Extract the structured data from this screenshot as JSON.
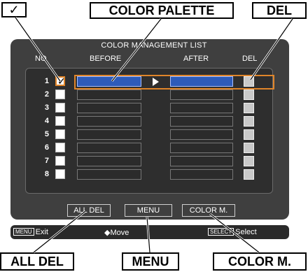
{
  "callouts": {
    "checkbox": "✓",
    "palette": "COLOR PALETTE",
    "del": "DEL",
    "all_del": "ALL DEL",
    "menu": "MENU",
    "color_m": "COLOR M."
  },
  "panel": {
    "title": "COLOR MANAGEMENT LIST",
    "columns": {
      "no": "NO",
      "before": "BEFORE",
      "after": "AFTER",
      "del": "DEL"
    }
  },
  "rows": [
    {
      "no": "1",
      "checked": true,
      "selected": true
    },
    {
      "no": "2",
      "checked": false,
      "selected": false
    },
    {
      "no": "3",
      "checked": false,
      "selected": false
    },
    {
      "no": "4",
      "checked": false,
      "selected": false
    },
    {
      "no": "5",
      "checked": false,
      "selected": false
    },
    {
      "no": "6",
      "checked": false,
      "selected": false
    },
    {
      "no": "7",
      "checked": false,
      "selected": false
    },
    {
      "no": "8",
      "checked": false,
      "selected": false
    }
  ],
  "buttons": {
    "all_del": "ALL DEL",
    "menu": "MENU",
    "color_m": "COLOR M."
  },
  "status_bar": {
    "exit_key": "MENU",
    "exit": "Exit",
    "move": "◆Move",
    "select_key": "SELECT",
    "select": "Select"
  },
  "colors": {
    "panel": "#3f3f3f",
    "swatch_blue": "#2d5bb9",
    "selection_frame": "#e0852a"
  }
}
